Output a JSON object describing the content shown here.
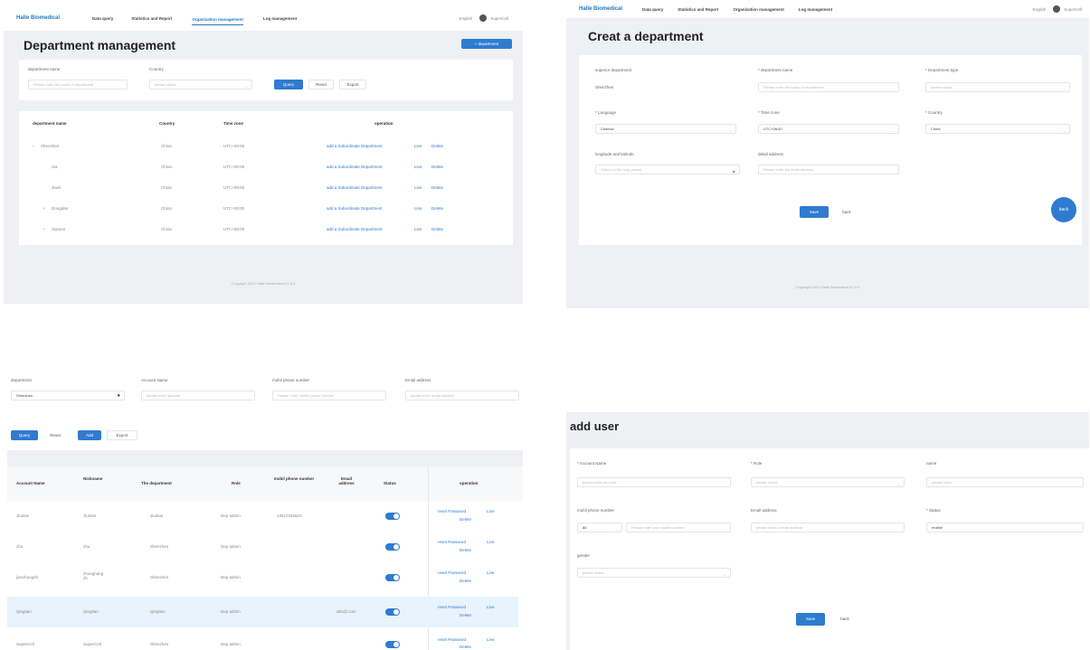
{
  "panel1": {
    "logo": "Halle Biomedical",
    "nav": [
      "Data query",
      "Statistics and Report",
      "Organization management",
      "Log management"
    ],
    "lang": "English",
    "user": "SuperCell",
    "title": "Department management",
    "add_button": "+ department",
    "filter_dept_label": "department name",
    "filter_dept_placeholder": "Please enter the name of department",
    "filter_country_label": "Country",
    "filter_country_placeholder": "please select",
    "query": "Query",
    "reset": "Reset",
    "export": "Export",
    "headers": [
      "department name",
      "Country",
      "Time zone",
      "operation"
    ],
    "rows": [
      {
        "name": "Shenzhen",
        "prefix": "−",
        "country": "China",
        "tz": "UTC+08:00"
      },
      {
        "name": "Xia",
        "prefix": "",
        "country": "China",
        "tz": "UTC+08:00"
      },
      {
        "name": "Jiwei",
        "prefix": "",
        "country": "China",
        "tz": "UTC+08:00"
      },
      {
        "name": "Dongdan",
        "prefix": "+",
        "country": "China",
        "tz": "UTC+08:00"
      },
      {
        "name": "Xiamen",
        "prefix": "+",
        "country": "China",
        "tz": "UTC+08:00"
      }
    ],
    "op_add": "add a Subordinate Department",
    "op_edit": "Line",
    "op_delete": "Delete",
    "footer": "Copyright 2022 Halle Biomedical V1.0.0"
  },
  "panel2": {
    "logo": "Halle Biomedical",
    "nav": [
      "Data query",
      "Statistics and Report",
      "Organization management",
      "Log management"
    ],
    "lang": "English",
    "user": "SuperCell",
    "title": "Creat a department",
    "f_superior_label": "superior department",
    "f_superior_value": "Shenzhen",
    "f_name_label": "* department name",
    "f_name_placeholder": "Please enter the name of department",
    "f_type_label": "* Department type",
    "f_type_placeholder": "please select",
    "f_lang_label": "* Language",
    "f_lang_value": "Chinese",
    "f_tz_label": "* Time zone",
    "f_tz_value": "UTC+08:00",
    "f_country_label": "* Country",
    "f_country_value": "China",
    "f_coord_label": "longitude and latitude",
    "f_coord_placeholder": "Select on the map please",
    "f_addr_label": "detail address",
    "f_addr_placeholder": "Please enter the detail address",
    "save": "Save",
    "back": "back",
    "fab": "back",
    "footer": "Copyright 2022 Halle Biomedical V1.0.0"
  },
  "panel3": {
    "f_dept_label": "department",
    "f_dept_value": "Shenzhen",
    "f_account_label": "Account Name",
    "f_account_placeholder": "please enter account",
    "f_phone_label": "mobil phone number",
    "f_phone_placeholder": "Please enter mobile phone number",
    "f_email_label": "Email address",
    "f_email_placeholder": "please enter email address",
    "query": "Query",
    "reset": "Reset",
    "add": "Add",
    "export": "Export",
    "headers": [
      "Account Name",
      "Nickname",
      "The department",
      "Role",
      "mobil phone number",
      "Email address",
      "Status",
      "operation"
    ],
    "rows": [
      {
        "account": "Jiunlan",
        "nick": "Jiunlan",
        "dept": "Jiunlan",
        "role": "Dep admin",
        "phone": "13612345623",
        "email": ""
      },
      {
        "account": "zhu",
        "nick": "zhu",
        "dept": "Shenzhen",
        "role": "Dep admin",
        "phone": "",
        "email": ""
      },
      {
        "account": "jianzhongzh",
        "nick": "zhonghang zh",
        "dept": "Shenzhen",
        "role": "Dep admin",
        "phone": "",
        "email": ""
      },
      {
        "account": "Qingtian",
        "nick": "Qingtian",
        "dept": "Qingtian",
        "role": "Dep admin",
        "phone": "",
        "email": "abc@.com"
      },
      {
        "account": "SuperCell",
        "nick": "SuperCell",
        "dept": "Shenzhen",
        "role": "Dep admin",
        "phone": "",
        "email": ""
      }
    ],
    "op_reset": "reset Password",
    "op_edit": "Line",
    "op_delete": "Delete"
  },
  "panel4": {
    "title": "add user",
    "f_account_label": "* Account Name",
    "f_account_placeholder": "please enter account",
    "f_role_label": "* Role",
    "f_role_placeholder": "please select",
    "f_name_label": "name",
    "f_name_placeholder": "please enter",
    "f_phone_label": "mobil phone number",
    "f_phone_code": "86",
    "f_phone_placeholder": "Please enter your mobile number",
    "f_email_label": "Email address",
    "f_email_placeholder": "please enter a email address",
    "f_status_label": "* Status",
    "f_status_value": "enable",
    "f_gender_label": "gender",
    "f_gender_placeholder": "please select",
    "save": "Save",
    "back": "back"
  },
  "colors": {
    "primary": "#2e7bd0",
    "page_bg": "#eef0f4",
    "card_bg": "#ffffff",
    "row_highlight": "#e8f3fb"
  }
}
